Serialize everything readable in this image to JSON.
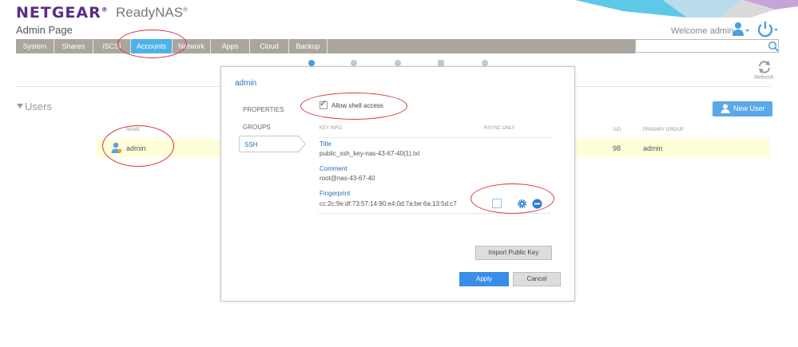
{
  "header": {
    "brand": "NETGEAR",
    "brand_mark": "®",
    "product": "ReadyNAS",
    "product_mark": "®",
    "page_title": "Admin Page",
    "welcome": "Welcome admin"
  },
  "tabs": [
    {
      "label": "System",
      "active": false
    },
    {
      "label": "Shares",
      "active": false
    },
    {
      "label": "iSCSI",
      "active": false
    },
    {
      "label": "Accounts",
      "active": true
    },
    {
      "label": "Network",
      "active": false
    },
    {
      "label": "Apps",
      "active": false
    },
    {
      "label": "Cloud",
      "active": false
    },
    {
      "label": "Backup",
      "active": false
    }
  ],
  "search": {
    "placeholder": ""
  },
  "toolbar": {
    "refresh_label": "Refresh"
  },
  "users": {
    "title": "Users",
    "new_user_label": "New User",
    "columns": {
      "name": "NAME",
      "uid": "UID",
      "primary_group": "PRIMARY GROUP"
    },
    "rows": [
      {
        "name": "admin",
        "uid": "98",
        "primary_group": "admin"
      }
    ]
  },
  "dialog": {
    "title": "admin",
    "nav": [
      {
        "label": "PROPERTIES"
      },
      {
        "label": "GROUPS"
      },
      {
        "label": "SSH"
      }
    ],
    "allow_shell_label": "Allow shell access",
    "allow_shell_checked": true,
    "columns": {
      "key_info": "KEY INFO",
      "rsync_only": "RSYNC ONLY"
    },
    "key": {
      "title_label": "Title",
      "title_value": "public_ssh_key-nas-43-67-40(1).txt",
      "comment_label": "Comment",
      "comment_value": "root@nas-43-67-40",
      "fingerprint_label": "Fingerprint",
      "fingerprint_value": "cc:2c:9e:df:73:57:14:90:e4:0d:7a:be:6a:13:5d:c7",
      "rsync_only": false
    },
    "import_label": "Import Public Key",
    "apply_label": "Apply",
    "cancel_label": "Cancel"
  },
  "colors": {
    "brand": "#5a2d82",
    "accent": "#4db3e6",
    "primary_button": "#3a8de8",
    "annotation_ring": "#d6363b",
    "highlight_row": "#fffed8"
  }
}
